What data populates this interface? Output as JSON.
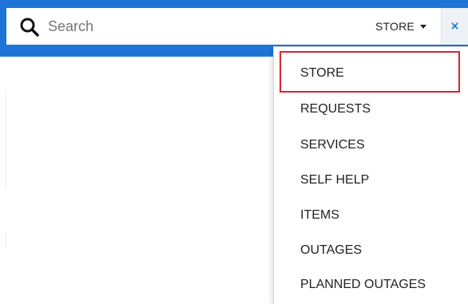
{
  "search": {
    "placeholder": "Search",
    "value": "",
    "icon": "search-icon",
    "scope_label": "STORE",
    "clear_icon": "close-icon",
    "clear_symbol": "×",
    "accent_color": "#1e74d6"
  },
  "dropdown": {
    "selected": "STORE",
    "highlight_color": "#d9242f",
    "items": [
      {
        "label": "STORE"
      },
      {
        "label": "REQUESTS"
      },
      {
        "label": "SERVICES"
      },
      {
        "label": "SELF HELP"
      },
      {
        "label": "ITEMS"
      },
      {
        "label": "OUTAGES"
      },
      {
        "label": "PLANNED OUTAGES"
      }
    ]
  }
}
